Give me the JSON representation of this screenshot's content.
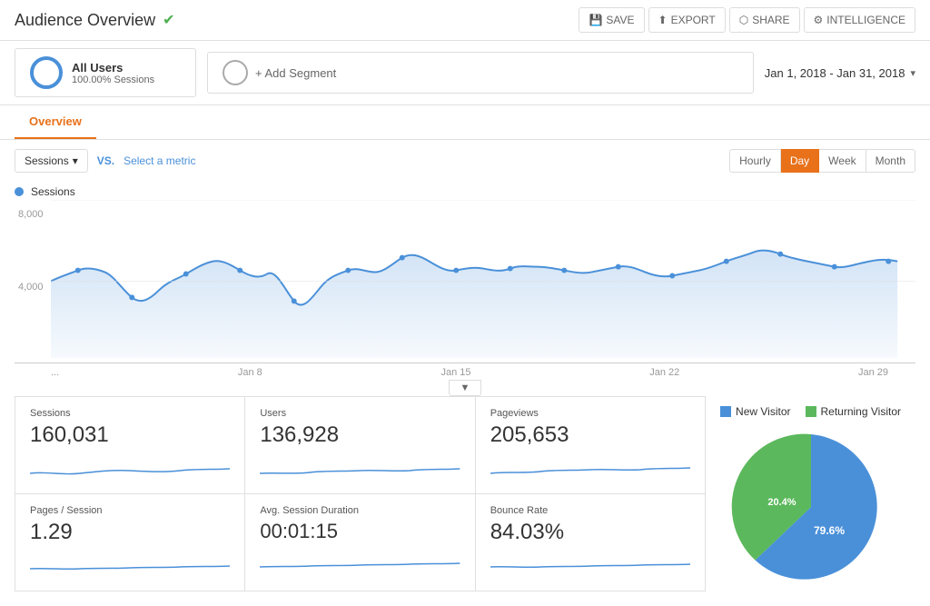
{
  "header": {
    "title": "Audience Overview",
    "check_icon": "✔",
    "actions": [
      {
        "id": "save",
        "icon": "💾",
        "label": "SAVE"
      },
      {
        "id": "export",
        "icon": "⬆",
        "label": "EXPORT"
      },
      {
        "id": "share",
        "icon": "⬡",
        "label": "SHARE"
      },
      {
        "id": "intelligence",
        "icon": "⚙",
        "label": "INTELLIGENCE"
      }
    ]
  },
  "segment": {
    "all_users_label": "All Users",
    "all_users_sub": "100.00% Sessions",
    "add_segment_label": "+ Add Segment"
  },
  "date_range": {
    "label": "Jan 1, 2018 - Jan 31, 2018"
  },
  "tabs": [
    {
      "id": "overview",
      "label": "Overview",
      "active": true
    }
  ],
  "toolbar": {
    "metric_label": "Sessions",
    "vs_label": "VS.",
    "select_metric_label": "Select a metric",
    "time_buttons": [
      {
        "id": "hourly",
        "label": "Hourly",
        "active": false
      },
      {
        "id": "day",
        "label": "Day",
        "active": true
      },
      {
        "id": "week",
        "label": "Week",
        "active": false
      },
      {
        "id": "month",
        "label": "Month",
        "active": false
      }
    ]
  },
  "chart": {
    "legend_label": "Sessions",
    "y_labels": [
      "8,000",
      "4,000"
    ],
    "x_labels": [
      "...",
      "Jan 8",
      "Jan 15",
      "Jan 22",
      "Jan 29"
    ],
    "expand_label": "▼"
  },
  "stats_row1": [
    {
      "id": "sessions",
      "label": "Sessions",
      "value": "160,031"
    },
    {
      "id": "users",
      "label": "Users",
      "value": "136,928"
    },
    {
      "id": "pageviews",
      "label": "Pageviews",
      "value": "205,653"
    }
  ],
  "stats_row2": [
    {
      "id": "pages_session",
      "label": "Pages / Session",
      "value": "1.29"
    },
    {
      "id": "avg_session",
      "label": "Avg. Session Duration",
      "value": "00:01:15"
    },
    {
      "id": "bounce_rate",
      "label": "Bounce Rate",
      "value": "84.03%"
    }
  ],
  "pie_chart": {
    "new_visitor_label": "New Visitor",
    "returning_visitor_label": "Returning Visitor",
    "new_pct": "79.6%",
    "returning_pct": "20.4%",
    "new_color": "#4a90d9",
    "returning_color": "#5cb85c"
  }
}
